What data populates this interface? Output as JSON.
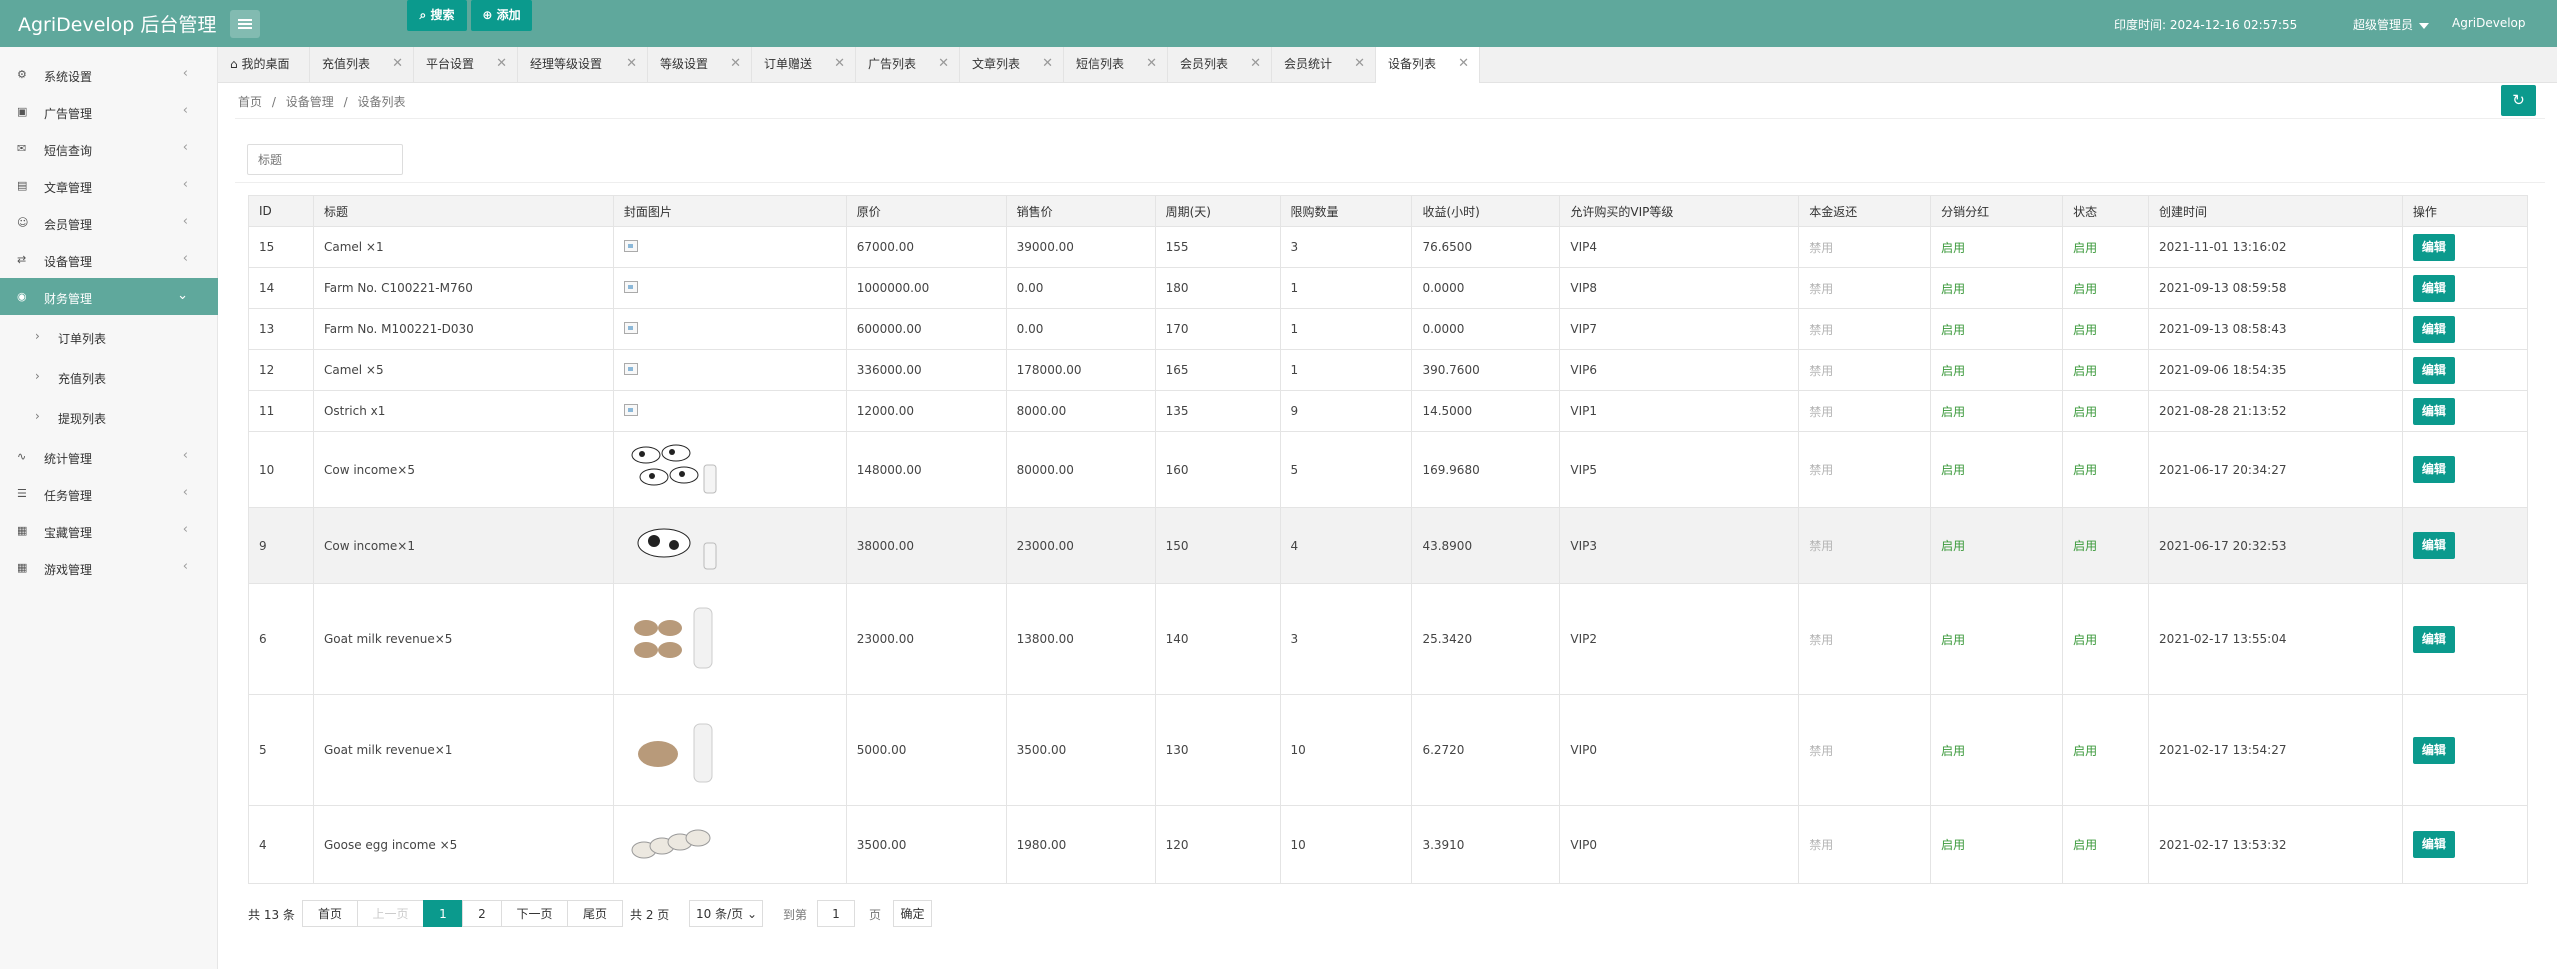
{
  "header": {
    "brand": "AgriDevelop 后台管理",
    "time_label": "印度时间: 2024-12-16 02:57:55",
    "role": "超级管理员",
    "username": "AgriDevelop"
  },
  "sidebar": {
    "items": [
      {
        "label": "系统设置",
        "icon": "gear-icon"
      },
      {
        "label": "广告管理",
        "icon": "image-icon"
      },
      {
        "label": "短信查询",
        "icon": "mail-icon"
      },
      {
        "label": "文章管理",
        "icon": "book-icon"
      },
      {
        "label": "会员管理",
        "icon": "user-icon"
      },
      {
        "label": "设备管理",
        "icon": "devices-icon"
      },
      {
        "label": "财务管理",
        "icon": "finance-icon"
      },
      {
        "label": "统计管理",
        "icon": "chart-icon"
      },
      {
        "label": "任务管理",
        "icon": "sliders-icon"
      },
      {
        "label": "宝藏管理",
        "icon": "box-icon"
      },
      {
        "label": "游戏管理",
        "icon": "game-icon"
      }
    ],
    "subitems": [
      "订单列表",
      "充值列表",
      "提现列表"
    ]
  },
  "tabs": [
    "我的桌面",
    "充值列表",
    "平台设置",
    "经理等级设置",
    "等级设置",
    "订单赠送",
    "广告列表",
    "文章列表",
    "短信列表",
    "会员列表",
    "会员统计",
    "设备列表"
  ],
  "breadcrumb": [
    "首页",
    "/",
    "设备管理",
    "/",
    "设备列表"
  ],
  "search": {
    "placeholder": "标题",
    "search_label": "搜索",
    "add_label": "添加"
  },
  "table": {
    "headers": [
      "ID",
      "标题",
      "封面图片",
      "原价",
      "销售价",
      "周期(天)",
      "限购数量",
      "收益(小时)",
      "允许购买的VIP等级",
      "本金返还",
      "分销分红",
      "状态",
      "创建时间",
      "操作"
    ],
    "rows": [
      {
        "id": "15",
        "title": "Camel ×1",
        "img": "broken",
        "price": "67000.00",
        "sale": "39000.00",
        "cycle": "155",
        "limit": "3",
        "income": "76.6500",
        "vip": "VIP4",
        "principal": "禁用",
        "dist": "启用",
        "status": "启用",
        "created": "2021-11-01 13:16:02",
        "op": "编辑"
      },
      {
        "id": "14",
        "title": "Farm No. C100221-M760",
        "img": "broken",
        "price": "1000000.00",
        "sale": "0.00",
        "cycle": "180",
        "limit": "1",
        "income": "0.0000",
        "vip": "VIP8",
        "principal": "禁用",
        "dist": "启用",
        "status": "启用",
        "created": "2021-09-13 08:59:58",
        "op": "编辑"
      },
      {
        "id": "13",
        "title": "Farm No. M100221-D030",
        "img": "broken",
        "price": "600000.00",
        "sale": "0.00",
        "cycle": "170",
        "limit": "1",
        "income": "0.0000",
        "vip": "VIP7",
        "principal": "禁用",
        "dist": "启用",
        "status": "启用",
        "created": "2021-09-13 08:58:43",
        "op": "编辑"
      },
      {
        "id": "12",
        "title": "Camel ×5",
        "img": "broken",
        "price": "336000.00",
        "sale": "178000.00",
        "cycle": "165",
        "limit": "1",
        "income": "390.7600",
        "vip": "VIP6",
        "principal": "禁用",
        "dist": "启用",
        "status": "启用",
        "created": "2021-09-06 18:54:35",
        "op": "编辑"
      },
      {
        "id": "11",
        "title": "Ostrich x1",
        "img": "broken",
        "price": "12000.00",
        "sale": "8000.00",
        "cycle": "135",
        "limit": "9",
        "income": "14.5000",
        "vip": "VIP1",
        "principal": "禁用",
        "dist": "启用",
        "status": "启用",
        "created": "2021-08-28 21:13:52",
        "op": "编辑"
      },
      {
        "id": "10",
        "title": "Cow income×5",
        "img": "cows",
        "price": "148000.00",
        "sale": "80000.00",
        "cycle": "160",
        "limit": "5",
        "income": "169.9680",
        "vip": "VIP5",
        "principal": "禁用",
        "dist": "启用",
        "status": "启用",
        "created": "2021-06-17 20:34:27",
        "op": "编辑"
      },
      {
        "id": "9",
        "title": "Cow income×1",
        "img": "cow",
        "price": "38000.00",
        "sale": "23000.00",
        "cycle": "150",
        "limit": "4",
        "income": "43.8900",
        "vip": "VIP3",
        "principal": "禁用",
        "dist": "启用",
        "status": "启用",
        "created": "2021-06-17 20:32:53",
        "op": "编辑"
      },
      {
        "id": "6",
        "title": "Goat milk revenue×5",
        "img": "goats",
        "price": "23000.00",
        "sale": "13800.00",
        "cycle": "140",
        "limit": "3",
        "income": "25.3420",
        "vip": "VIP2",
        "principal": "禁用",
        "dist": "启用",
        "status": "启用",
        "created": "2021-02-17 13:55:04",
        "op": "编辑"
      },
      {
        "id": "5",
        "title": "Goat milk revenue×1",
        "img": "goat",
        "price": "5000.00",
        "sale": "3500.00",
        "cycle": "130",
        "limit": "10",
        "income": "6.2720",
        "vip": "VIP0",
        "principal": "禁用",
        "dist": "启用",
        "status": "启用",
        "created": "2021-02-17 13:54:27",
        "op": "编辑"
      },
      {
        "id": "4",
        "title": "Goose egg income ×5",
        "img": "geese",
        "price": "3500.00",
        "sale": "1980.00",
        "cycle": "120",
        "limit": "10",
        "income": "3.3910",
        "vip": "VIP0",
        "principal": "禁用",
        "dist": "启用",
        "status": "启用",
        "created": "2021-02-17 13:53:32",
        "op": "编辑"
      }
    ]
  },
  "pagination": {
    "total": "共 13 条",
    "first": "首页",
    "prev": "上一页",
    "page1": "1",
    "page2": "2",
    "next": "下一页",
    "last": "尾页",
    "pages": "共 2 页",
    "per_page": "10 条/页",
    "goto": "到第",
    "goto_value": "1",
    "page_unit": "页",
    "confirm": "确定"
  },
  "colors": {
    "header": "#5fa89c",
    "accent": "#0b9a8d",
    "enabled": "#3c9a3c",
    "disabled": "#b5b5b5"
  }
}
